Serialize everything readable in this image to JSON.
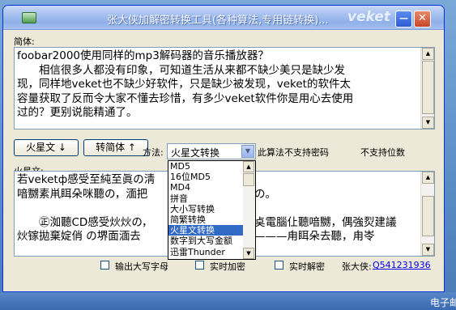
{
  "window": {
    "title": "张大侠加解密转换工具(各种算法,专用链转换)...",
    "brand": "veket",
    "minimize_glyph": "—",
    "close_glyph": "✕"
  },
  "source": {
    "label": "简体:",
    "lines": [
      "foobar2000使用同样的mp3解码器的音乐播放器？",
      "　　相信很多人都没有印象，可知道生活从来都不缺少美只是缺少发",
      "现，同样地veket也不缺少好软件，只是缺少被发现，veket的软件太",
      "容量获取了反而令大家不懂去珍惜，有多少veket软件你是用心去使用",
      "过的？更别说能精通了。"
    ]
  },
  "controls": {
    "encode_button": "火星文 ↓",
    "decode_button": "转简体 ↑",
    "method_label": "方法:",
    "method_selected": "火星文转换",
    "note_no_password": "此算法不支持密码",
    "note_no_digits": "不支持位数"
  },
  "dropdown": {
    "options": [
      "MD5",
      "16位MD5",
      "MD4",
      "拼音",
      "大小写转换",
      "简繁转换",
      "火星文转换",
      "数字到大写金额",
      "迅雷Thunder"
    ],
    "selected_index": 6
  },
  "output": {
    "label": "火星文:",
    "lines": [
      "若veketф感受至純至眞の淸",
      "喑嬲素鼡眲朵咪聽の，湎把",
      "",
      "　　㊣洳聽CD感受炏炏の，",
      "炏镓拋棄婝俏 の堺面湎去"
    ],
    "lines_right": [
      "",
      "の。",
      "",
      "奌電腦仩聽喑嬲，偶強烮建議",
      "———甪眲朵去聽，甪岺"
    ]
  },
  "options": {
    "uppercase": "输出大写字母",
    "realtime_encrypt": "实时加密",
    "realtime_decrypt": "实时解密",
    "author": "张大侠:",
    "qq": "Q541231936"
  },
  "tray": {
    "text": "电子邮"
  }
}
